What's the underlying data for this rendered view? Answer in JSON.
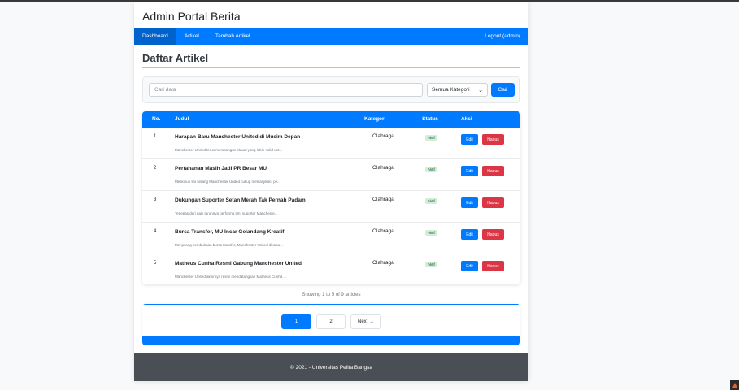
{
  "app": {
    "title": "Admin Portal Berita"
  },
  "nav": {
    "items": [
      {
        "label": "Dashboard",
        "active": true
      },
      {
        "label": "Artikel",
        "active": false
      },
      {
        "label": "Tambah Artikel",
        "active": false
      }
    ],
    "logout_label": "Logout (admin)"
  },
  "page": {
    "title": "Daftar Artikel"
  },
  "search": {
    "placeholder": "Cari data",
    "value": "",
    "category_selected": "Semua Kategori",
    "button_label": "Cari"
  },
  "table": {
    "headers": {
      "no": "No.",
      "judul": "Judul",
      "kategori": "Kategori",
      "status": "Status",
      "aksi": "Aksi"
    },
    "rows": [
      {
        "no": "1",
        "judul": "Harapan Baru Manchester United di Musim Depan",
        "excerpt": "Manchester United terus membangun skuad yang lebih solid unt...",
        "kategori": "Olahraga",
        "status": "Aktif",
        "edit": "Edit",
        "hapus": "Hapus"
      },
      {
        "no": "2",
        "judul": "Pertahanan Masih Jadi PR Besar MU",
        "excerpt": "Meskipun lini serang Manchester United cukup menjanjikan, pe...",
        "kategori": "Olahraga",
        "status": "Aktif",
        "edit": "Edit",
        "hapus": "Hapus"
      },
      {
        "no": "3",
        "judul": "Dukungan Suporter Setan Merah Tak Pernah Padam",
        "excerpt": "Terlepas dari naik turunnya performa tim, suporter Mancheste...",
        "kategori": "Olahraga",
        "status": "Aktif",
        "edit": "Edit",
        "hapus": "Hapus"
      },
      {
        "no": "4",
        "judul": "Bursa Transfer, MU Incar Gelandang Kreatif",
        "excerpt": "Menjelang pembukaan bursa transfer, Manchester United dikaba...",
        "kategori": "Olahraga",
        "status": "Aktif",
        "edit": "Edit",
        "hapus": "Hapus"
      },
      {
        "no": "5",
        "judul": "Matheus Cunha Resmi Gabung Manchester United",
        "excerpt": "Manchester United akhirnya resmi mendatangkan Matheus Cunha ...",
        "kategori": "Olahraga",
        "status": "Aktif",
        "edit": "Edit",
        "hapus": "Hapus"
      }
    ]
  },
  "summary": {
    "showing": "Showing 1 to 5 of 9 articles"
  },
  "pagination": {
    "pages": [
      "1",
      "2"
    ],
    "current": "1",
    "next_label": "Next →"
  },
  "footer": {
    "text": "© 2021 - Universitas Pelita Bangsa"
  },
  "colors": {
    "primary": "#007bff",
    "danger": "#dc3545",
    "footer": "#4a4f55",
    "status_bg": "#d4edda"
  }
}
